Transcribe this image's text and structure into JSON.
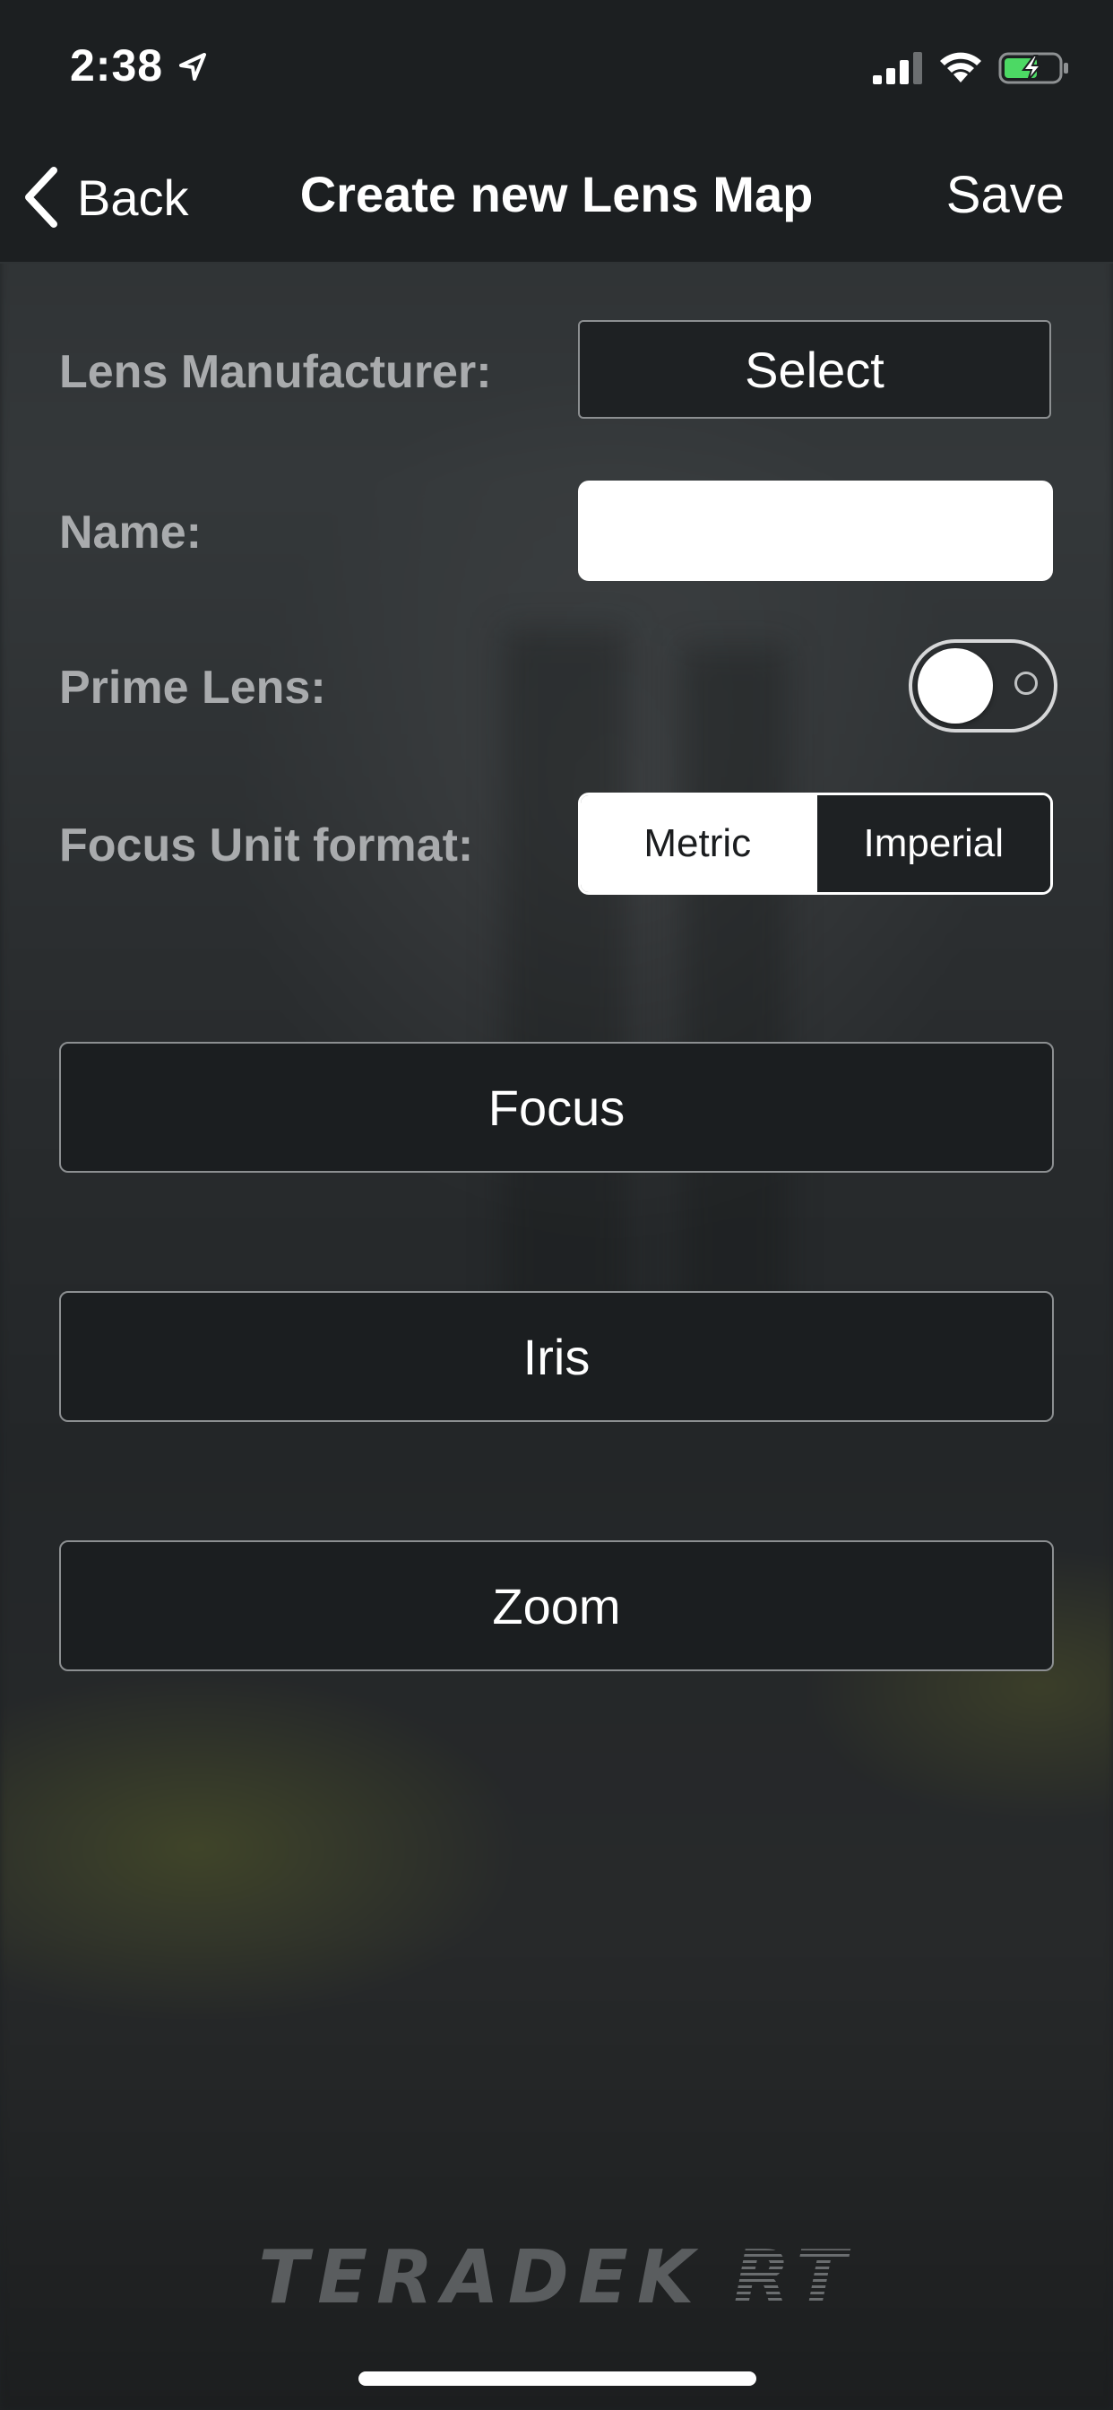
{
  "status_bar": {
    "time": "2:38",
    "icons": [
      "location-arrow-icon",
      "cellular-signal-icon",
      "wifi-icon",
      "battery-charging-icon"
    ],
    "battery_color": "#4cd964"
  },
  "nav": {
    "back_label": "Back",
    "title": "Create new Lens Map",
    "save_label": "Save"
  },
  "form": {
    "manufacturer_label": "Lens Manufacturer:",
    "manufacturer_value": "Select",
    "name_label": "Name:",
    "name_value": "",
    "prime_label": "Prime Lens:",
    "prime_on": false,
    "focus_unit_label": "Focus Unit format:",
    "focus_unit_options": [
      "Metric",
      "Imperial"
    ],
    "focus_unit_selected": "Metric"
  },
  "buttons": {
    "focus": "Focus",
    "iris": "Iris",
    "zoom": "Zoom"
  },
  "branding": {
    "logo_main": "TERADEK",
    "logo_suffix": "RT"
  },
  "colors": {
    "bar_bg": "#1c1f21",
    "label_gray": "#a9abad",
    "accent_white": "#ffffff"
  }
}
